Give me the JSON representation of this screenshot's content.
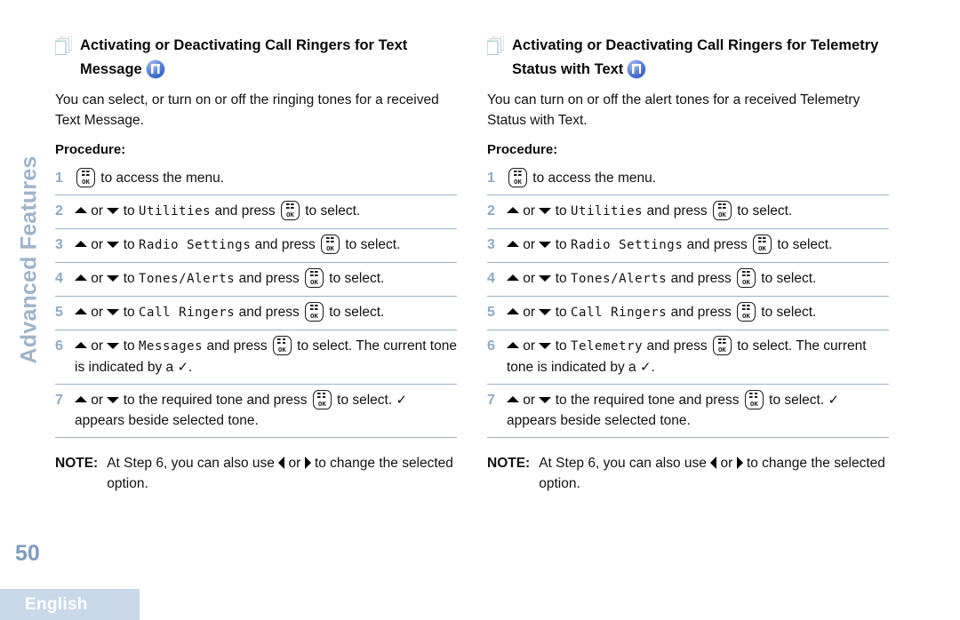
{
  "chapter": {
    "vertical_title": "Advanced Features",
    "page_number": "50"
  },
  "footer": {
    "language": "English"
  },
  "icons": {
    "pages": "pages-icon",
    "tone_badge": "tone-alert-icon",
    "ok_key": "ok-key-icon",
    "up": "triangle-up-icon",
    "down": "triangle-down-icon",
    "left": "triangle-left-icon",
    "right": "triangle-right-icon",
    "check": "check-mark-icon"
  },
  "colors": {
    "step_number": "#8fa9c2",
    "rule": "#9bb4cd",
    "chapter_tab": "#9fb4c9",
    "page_number": "#7f9cba",
    "footer_tab_bg": "#c9d9e9",
    "footer_tab_text": "#ffffff"
  },
  "columns": [
    {
      "heading": "Activating or Deactivating Call Ringers for Text Message",
      "intro": "You can select, or turn on or off the ringing tones for a received Text Message.",
      "procedure_label": "Procedure:",
      "steps": [
        {
          "num": "1",
          "parts": [
            {
              "type": "okkey"
            },
            {
              "type": "text",
              "value": " to access the menu."
            }
          ]
        },
        {
          "num": "2",
          "parts": [
            {
              "type": "up"
            },
            {
              "type": "text",
              "value": " or "
            },
            {
              "type": "down"
            },
            {
              "type": "text",
              "value": " to "
            },
            {
              "type": "lcd",
              "value": "Utilities"
            },
            {
              "type": "text",
              "value": " and press "
            },
            {
              "type": "okkey"
            },
            {
              "type": "text",
              "value": " to select."
            }
          ]
        },
        {
          "num": "3",
          "parts": [
            {
              "type": "up"
            },
            {
              "type": "text",
              "value": " or "
            },
            {
              "type": "down"
            },
            {
              "type": "text",
              "value": " to "
            },
            {
              "type": "lcd",
              "value": "Radio Settings"
            },
            {
              "type": "text",
              "value": " and press "
            },
            {
              "type": "okkey"
            },
            {
              "type": "text",
              "value": " to select."
            }
          ]
        },
        {
          "num": "4",
          "parts": [
            {
              "type": "up"
            },
            {
              "type": "text",
              "value": " or "
            },
            {
              "type": "down"
            },
            {
              "type": "text",
              "value": " to "
            },
            {
              "type": "lcd",
              "value": "Tones/Alerts"
            },
            {
              "type": "text",
              "value": " and press "
            },
            {
              "type": "okkey"
            },
            {
              "type": "text",
              "value": " to select."
            }
          ]
        },
        {
          "num": "5",
          "parts": [
            {
              "type": "up"
            },
            {
              "type": "text",
              "value": " or "
            },
            {
              "type": "down"
            },
            {
              "type": "text",
              "value": " to "
            },
            {
              "type": "lcd",
              "value": "Call Ringers"
            },
            {
              "type": "text",
              "value": " and press "
            },
            {
              "type": "okkey"
            },
            {
              "type": "text",
              "value": " to select."
            }
          ]
        },
        {
          "num": "6",
          "parts": [
            {
              "type": "up"
            },
            {
              "type": "text",
              "value": " or "
            },
            {
              "type": "down"
            },
            {
              "type": "text",
              "value": " to "
            },
            {
              "type": "lcd",
              "value": "Messages"
            },
            {
              "type": "text",
              "value": " and press "
            },
            {
              "type": "okkey"
            },
            {
              "type": "text",
              "value": " to select. The current tone is indicated by a "
            },
            {
              "type": "check"
            },
            {
              "type": "text",
              "value": "."
            }
          ]
        },
        {
          "num": "7",
          "parts": [
            {
              "type": "up"
            },
            {
              "type": "text",
              "value": " or "
            },
            {
              "type": "down"
            },
            {
              "type": "text",
              "value": " to the required tone and press "
            },
            {
              "type": "okkey"
            },
            {
              "type": "text",
              "value": " to select. "
            },
            {
              "type": "check"
            },
            {
              "type": "text",
              "value": " appears beside selected tone."
            }
          ]
        }
      ],
      "note": {
        "label": "NOTE:",
        "parts": [
          {
            "type": "text",
            "value": "At Step 6, you can also use "
          },
          {
            "type": "left"
          },
          {
            "type": "text",
            "value": " or "
          },
          {
            "type": "right"
          },
          {
            "type": "text",
            "value": " to change the selected option."
          }
        ]
      }
    },
    {
      "heading": "Activating or Deactivating Call Ringers for Telemetry Status with Text",
      "intro": "You can turn on or off the alert tones for a received Telemetry Status with Text.",
      "procedure_label": "Procedure:",
      "steps": [
        {
          "num": "1",
          "parts": [
            {
              "type": "okkey"
            },
            {
              "type": "text",
              "value": " to access the menu."
            }
          ]
        },
        {
          "num": "2",
          "parts": [
            {
              "type": "up"
            },
            {
              "type": "text",
              "value": " or "
            },
            {
              "type": "down"
            },
            {
              "type": "text",
              "value": " to "
            },
            {
              "type": "lcd",
              "value": "Utilities"
            },
            {
              "type": "text",
              "value": " and press "
            },
            {
              "type": "okkey"
            },
            {
              "type": "text",
              "value": " to select."
            }
          ]
        },
        {
          "num": "3",
          "parts": [
            {
              "type": "up"
            },
            {
              "type": "text",
              "value": " or "
            },
            {
              "type": "down"
            },
            {
              "type": "text",
              "value": " to "
            },
            {
              "type": "lcd",
              "value": "Radio Settings"
            },
            {
              "type": "text",
              "value": " and press "
            },
            {
              "type": "okkey"
            },
            {
              "type": "text",
              "value": " to select."
            }
          ]
        },
        {
          "num": "4",
          "parts": [
            {
              "type": "up"
            },
            {
              "type": "text",
              "value": " or "
            },
            {
              "type": "down"
            },
            {
              "type": "text",
              "value": " to "
            },
            {
              "type": "lcd",
              "value": "Tones/Alerts"
            },
            {
              "type": "text",
              "value": " and press "
            },
            {
              "type": "okkey"
            },
            {
              "type": "text",
              "value": " to select."
            }
          ]
        },
        {
          "num": "5",
          "parts": [
            {
              "type": "up"
            },
            {
              "type": "text",
              "value": " or "
            },
            {
              "type": "down"
            },
            {
              "type": "text",
              "value": " to "
            },
            {
              "type": "lcd",
              "value": "Call Ringers"
            },
            {
              "type": "text",
              "value": " and press "
            },
            {
              "type": "okkey"
            },
            {
              "type": "text",
              "value": " to select."
            }
          ]
        },
        {
          "num": "6",
          "parts": [
            {
              "type": "up"
            },
            {
              "type": "text",
              "value": " or "
            },
            {
              "type": "down"
            },
            {
              "type": "text",
              "value": " to "
            },
            {
              "type": "lcd",
              "value": "Telemetry"
            },
            {
              "type": "text",
              "value": " and press "
            },
            {
              "type": "okkey"
            },
            {
              "type": "text",
              "value": " to select. The current tone is indicated by a "
            },
            {
              "type": "check"
            },
            {
              "type": "text",
              "value": "."
            }
          ]
        },
        {
          "num": "7",
          "parts": [
            {
              "type": "up"
            },
            {
              "type": "text",
              "value": " or "
            },
            {
              "type": "down"
            },
            {
              "type": "text",
              "value": " to the required tone and press "
            },
            {
              "type": "okkey"
            },
            {
              "type": "text",
              "value": " to select. "
            },
            {
              "type": "check"
            },
            {
              "type": "text",
              "value": " appears beside selected tone."
            }
          ]
        }
      ],
      "note": {
        "label": "NOTE:",
        "parts": [
          {
            "type": "text",
            "value": "At Step 6, you can also use "
          },
          {
            "type": "left"
          },
          {
            "type": "text",
            "value": " or "
          },
          {
            "type": "right"
          },
          {
            "type": "text",
            "value": " to change the selected option."
          }
        ]
      }
    }
  ]
}
